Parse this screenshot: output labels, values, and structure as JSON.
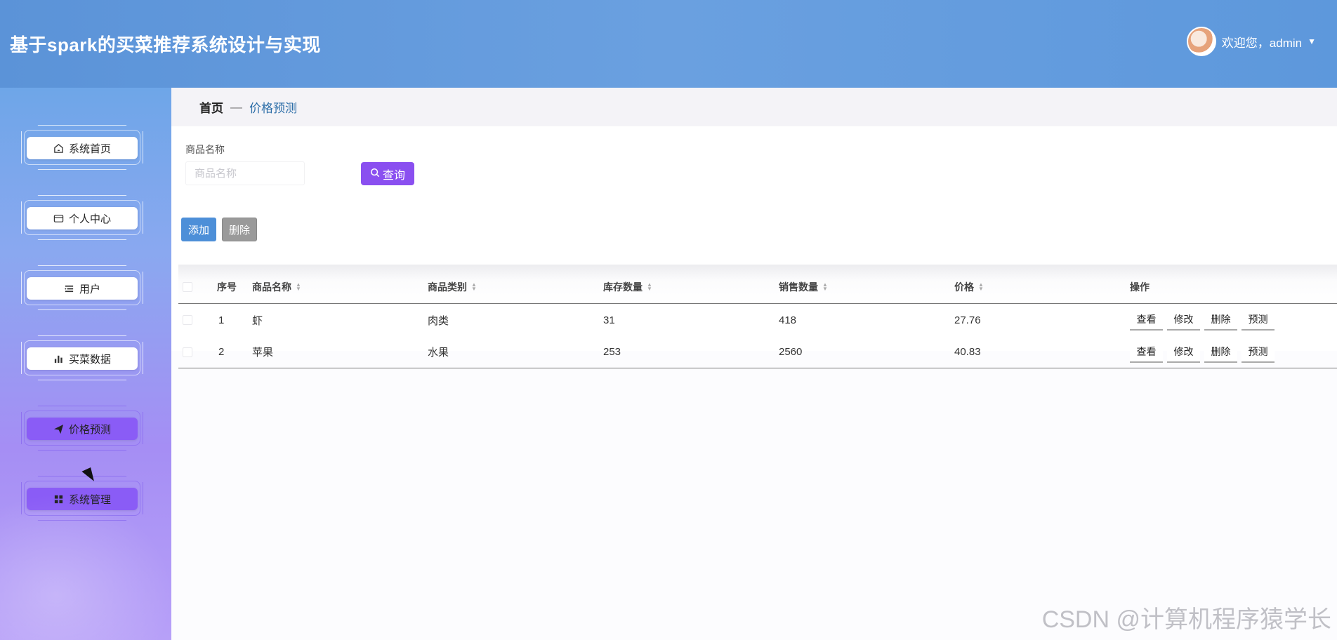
{
  "header": {
    "title": "基于spark的买菜推荐系统设计与实现",
    "welcome": "欢迎您，admin"
  },
  "sidebar": {
    "items": [
      {
        "label": "系统首页",
        "icon": "home-icon",
        "active": false
      },
      {
        "label": "个人中心",
        "icon": "card-icon",
        "active": false
      },
      {
        "label": "用户",
        "icon": "list-icon",
        "active": false
      },
      {
        "label": "买菜数据",
        "icon": "bar-chart-icon",
        "active": false
      },
      {
        "label": "价格预测",
        "icon": "paper-plane-icon",
        "active": true
      },
      {
        "label": "系统管理",
        "icon": "grid-icon",
        "active": true
      }
    ]
  },
  "breadcrumb": {
    "home": "首页",
    "separator": "—",
    "current": "价格预测"
  },
  "search": {
    "label": "商品名称",
    "placeholder": "商品名称",
    "query_label": "查询"
  },
  "actions": {
    "add_label": "添加",
    "delete_label": "删除"
  },
  "table": {
    "columns": [
      "序号",
      "商品名称",
      "商品类别",
      "库存数量",
      "销售数量",
      "价格",
      "操作"
    ],
    "rows": [
      {
        "index": "1",
        "name": "虾",
        "category": "肉类",
        "stock": "31",
        "sales": "418",
        "price": "27.76"
      },
      {
        "index": "2",
        "name": "苹果",
        "category": "水果",
        "stock": "253",
        "sales": "2560",
        "price": "40.83"
      }
    ],
    "row_actions": [
      "查看",
      "修改",
      "删除",
      "预测"
    ]
  },
  "watermark": "CSDN @计算机程序猿学长",
  "colors": {
    "header": "#5b93d8",
    "accent_purple": "#8a4ff0",
    "add_blue": "#4d8fd8",
    "delete_gray": "#9a9a9a",
    "breadcrumb_link": "#2d6ea8"
  }
}
